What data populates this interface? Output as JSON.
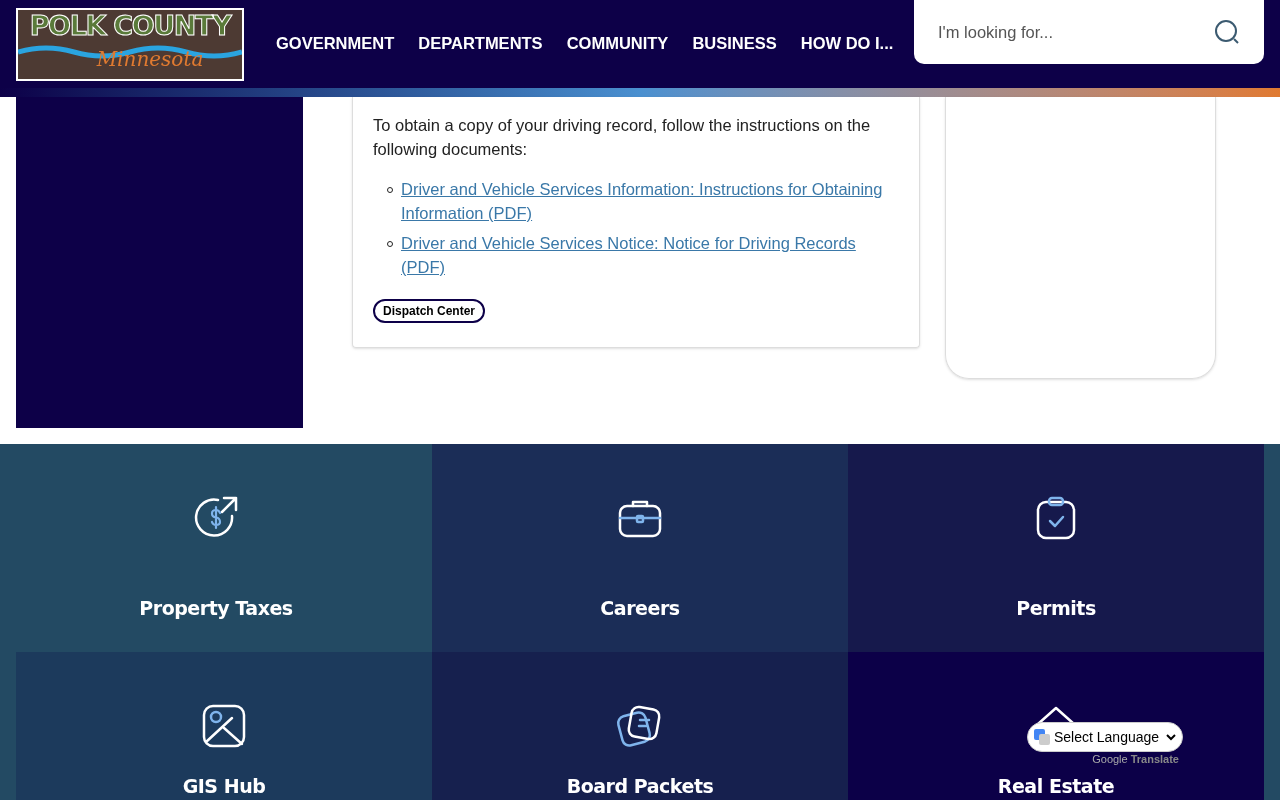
{
  "header": {
    "logo": {
      "title": "POLK COUNTY",
      "subtitle": "Minnesota"
    },
    "nav": [
      "GOVERNMENT",
      "DEPARTMENTS",
      "COMMUNITY",
      "BUSINESS",
      "HOW DO I..."
    ],
    "search": {
      "placeholder": "I'm looking for..."
    }
  },
  "content": {
    "paragraph": "To obtain a copy of your driving record, follow the instructions on the following documents:",
    "links": [
      "Driver and Vehicle Services Information: Instructions for Obtaining Information (PDF)",
      "Driver and Vehicle Services Notice: Notice for Driving Records (PDF)"
    ],
    "tag": "Dispatch Center"
  },
  "tiles": [
    {
      "label": "Property Taxes",
      "kind": "taxes",
      "color": "#234a63"
    },
    {
      "label": "Careers",
      "kind": "briefcase",
      "color": "#1b2d57"
    },
    {
      "label": "Permits",
      "kind": "clipboard",
      "color": "#16194c"
    },
    {
      "label": "GIS Hub",
      "kind": "map",
      "color": "#1c3a5c"
    },
    {
      "label": "Board Packets",
      "kind": "notes",
      "color": "#16204e"
    },
    {
      "label": "Real Estate",
      "kind": "house",
      "color": "#0c0048"
    }
  ],
  "translate": {
    "select": "Select Language",
    "powered": "Google",
    "service": "Translate"
  }
}
